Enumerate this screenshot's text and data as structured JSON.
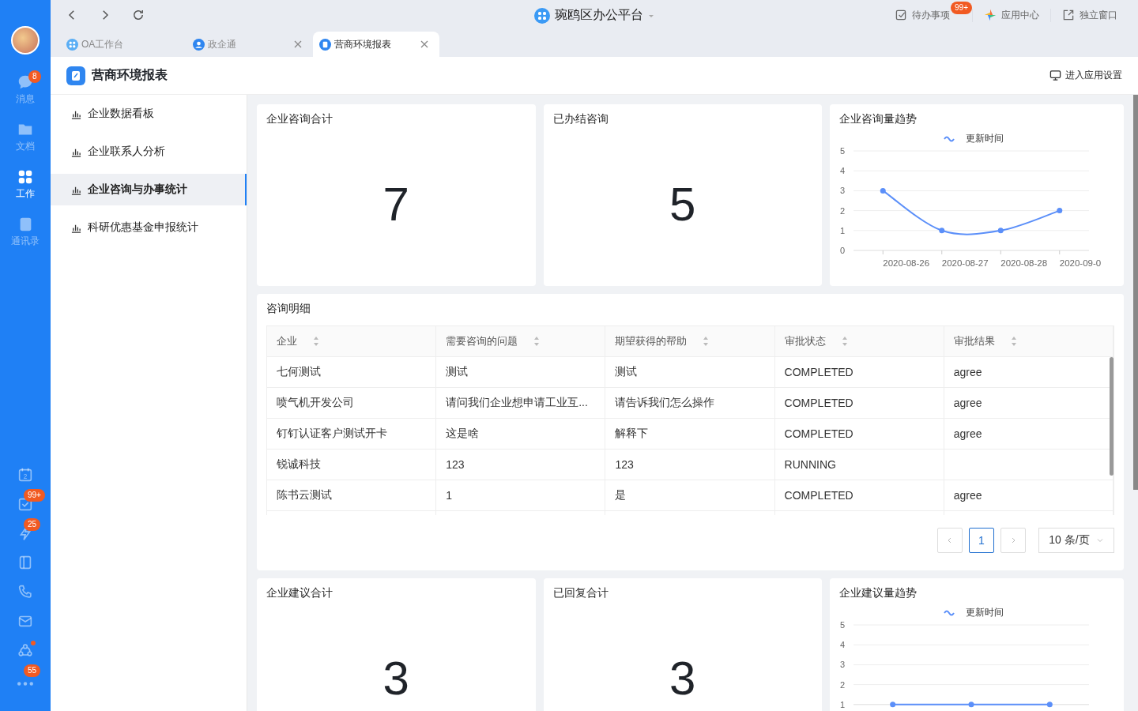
{
  "rail": {
    "items": [
      {
        "label": "消息",
        "badge": "8",
        "selected": false
      },
      {
        "label": "文档",
        "selected": false
      },
      {
        "label": "工作",
        "selected": true
      },
      {
        "label": "通讯录",
        "selected": false
      }
    ],
    "tools": [
      {
        "kind": "calendar",
        "day": "2"
      },
      {
        "kind": "todo",
        "badge": "99+"
      },
      {
        "kind": "bolt",
        "badge": "25"
      },
      {
        "kind": "notebook"
      },
      {
        "kind": "phone"
      },
      {
        "kind": "mail"
      },
      {
        "kind": "people",
        "dot": true
      },
      {
        "kind": "more",
        "badge": "55"
      }
    ]
  },
  "topbar": {
    "title": "琬鸥区办公平台",
    "actions": [
      {
        "label": "待办事项",
        "badge": "99+"
      },
      {
        "label": "应用中心"
      },
      {
        "label": "独立窗口"
      }
    ]
  },
  "tabs": [
    {
      "label": "OA工作台",
      "selected": false,
      "closable": false
    },
    {
      "label": "政企通",
      "selected": false,
      "closable": true
    },
    {
      "label": "营商环境报表",
      "selected": true,
      "closable": true
    }
  ],
  "header": {
    "title": "营商环境报表",
    "settings": "进入应用设置"
  },
  "menu": [
    {
      "label": "企业数据看板",
      "selected": false
    },
    {
      "label": "企业联系人分析",
      "selected": false
    },
    {
      "label": "企业咨询与办事统计",
      "selected": true
    },
    {
      "label": "科研优惠基金申报统计",
      "selected": false
    }
  ],
  "row1": {
    "stats": [
      {
        "title": "企业咨询合计",
        "value": "7"
      },
      {
        "title": "已办结咨询",
        "value": "5"
      }
    ],
    "trend": {
      "title": "企业咨询量趋势",
      "chart_data": {
        "type": "line",
        "categories": [
          "2020-08-26",
          "2020-08-27",
          "2020-08-28",
          "2020-09-0"
        ],
        "series": [
          {
            "name": "更新时间",
            "color": "#5b8ff9",
            "values": [
              3,
              1,
              1,
              2
            ],
            "marker": true
          }
        ],
        "ylim": [
          0,
          5
        ],
        "yticks": [
          0,
          1,
          2,
          3,
          4,
          5
        ],
        "grid": true
      }
    }
  },
  "details": {
    "title": "咨询明细",
    "columns": [
      "企业",
      "需要咨询的问题",
      "期望获得的帮助",
      "审批状态",
      "审批结果"
    ],
    "rows": [
      [
        "七何测试",
        "测试",
        "测试",
        "COMPLETED",
        "agree"
      ],
      [
        "喷气机开发公司",
        "请问我们企业想申请工业互...",
        "请告诉我们怎么操作",
        "COMPLETED",
        "agree"
      ],
      [
        "钉钉认证客户测试开卡",
        "这是啥",
        "解释下",
        "COMPLETED",
        "agree"
      ],
      [
        "锐诚科技",
        "123",
        "123",
        "RUNNING",
        ""
      ],
      [
        "陈书云测试",
        "1",
        "是",
        "COMPLETED",
        "agree"
      ]
    ],
    "pagination": {
      "page": "1",
      "page_size": "10 条/页"
    }
  },
  "row2": {
    "stats": [
      {
        "title": "企业建议合计",
        "value": "3"
      },
      {
        "title": "已回复合计",
        "value": "3"
      }
    ],
    "trend": {
      "title": "企业建议量趋势",
      "chart_data": {
        "type": "line",
        "series": [
          {
            "name": "更新时间",
            "color": "#5b8ff9",
            "values": [
              1,
              1,
              1
            ],
            "marker": true
          }
        ],
        "ylim": [
          1,
          5
        ],
        "yticks": [
          1,
          2,
          3,
          4,
          5
        ],
        "grid": true
      }
    }
  }
}
